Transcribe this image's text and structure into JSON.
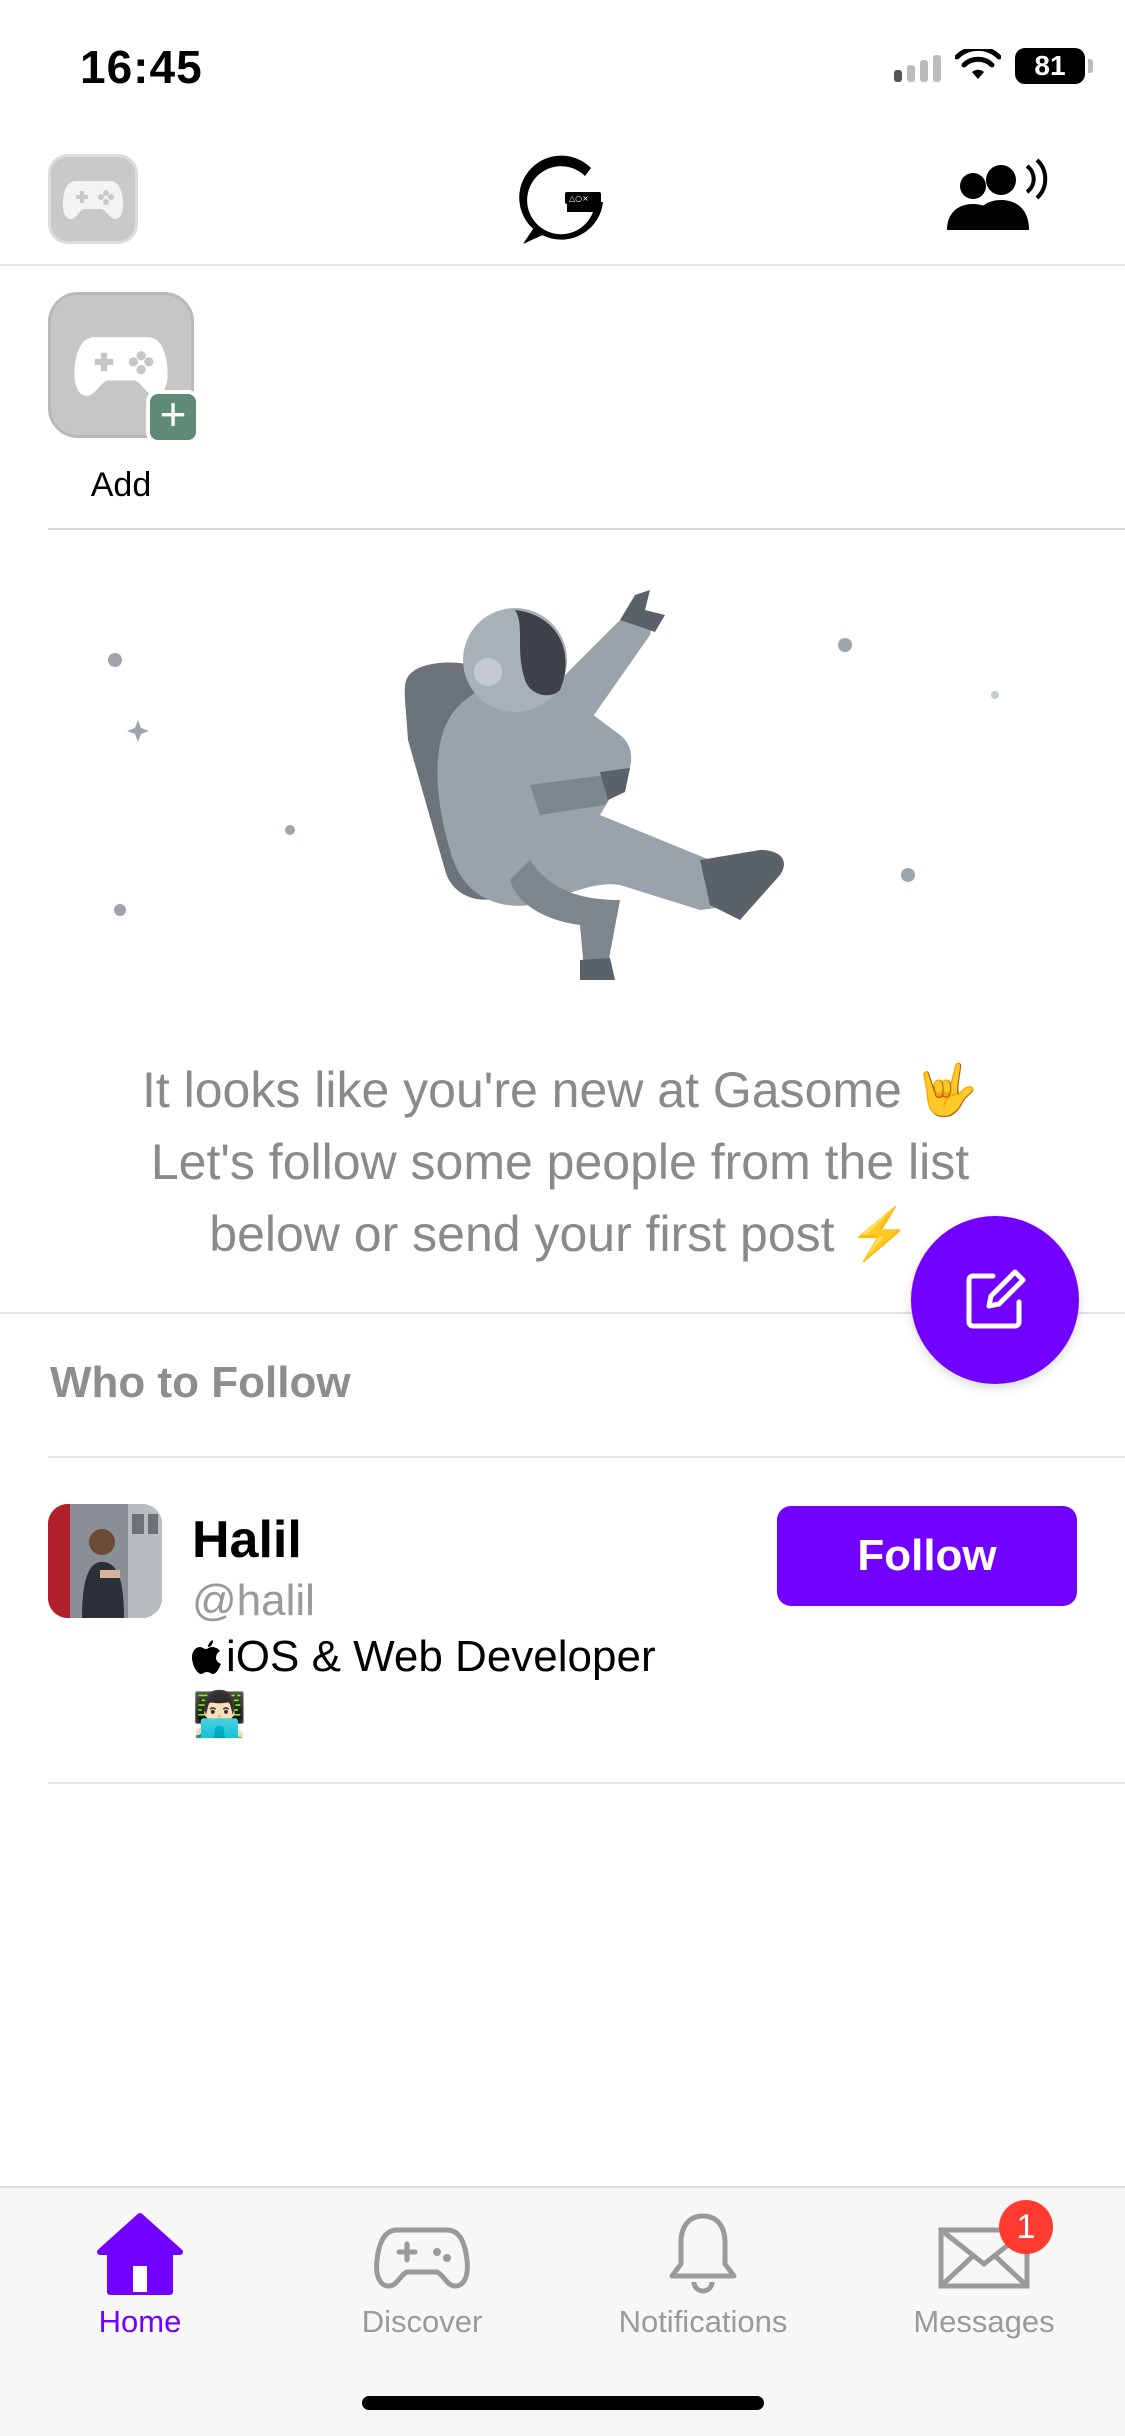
{
  "status_bar": {
    "time": "16:45",
    "battery": "81"
  },
  "header": {
    "logo_name": "gasome-logo"
  },
  "games": {
    "add_label": "Add",
    "plus": "+"
  },
  "empty_state": {
    "line1": "It looks like you're new at Gasome 🤟",
    "line2": "Let's follow some people from the list",
    "line3": "below or send your first post ⚡️"
  },
  "who_to_follow": {
    "title": "Who to Follow",
    "users": [
      {
        "name": "Halil",
        "handle": "@halil",
        "bio_line1": " iOS & Web Developer",
        "bio_line2": "👨🏻‍💻",
        "follow_label": "Follow"
      }
    ]
  },
  "tabs": [
    {
      "label": "Home",
      "active": true
    },
    {
      "label": "Discover",
      "active": false
    },
    {
      "label": "Notifications",
      "active": false
    },
    {
      "label": "Messages",
      "active": false,
      "badge": "1"
    }
  ],
  "colors": {
    "accent": "#7200ff",
    "badge": "#ff3b30",
    "add_plus": "#5e8a76"
  }
}
